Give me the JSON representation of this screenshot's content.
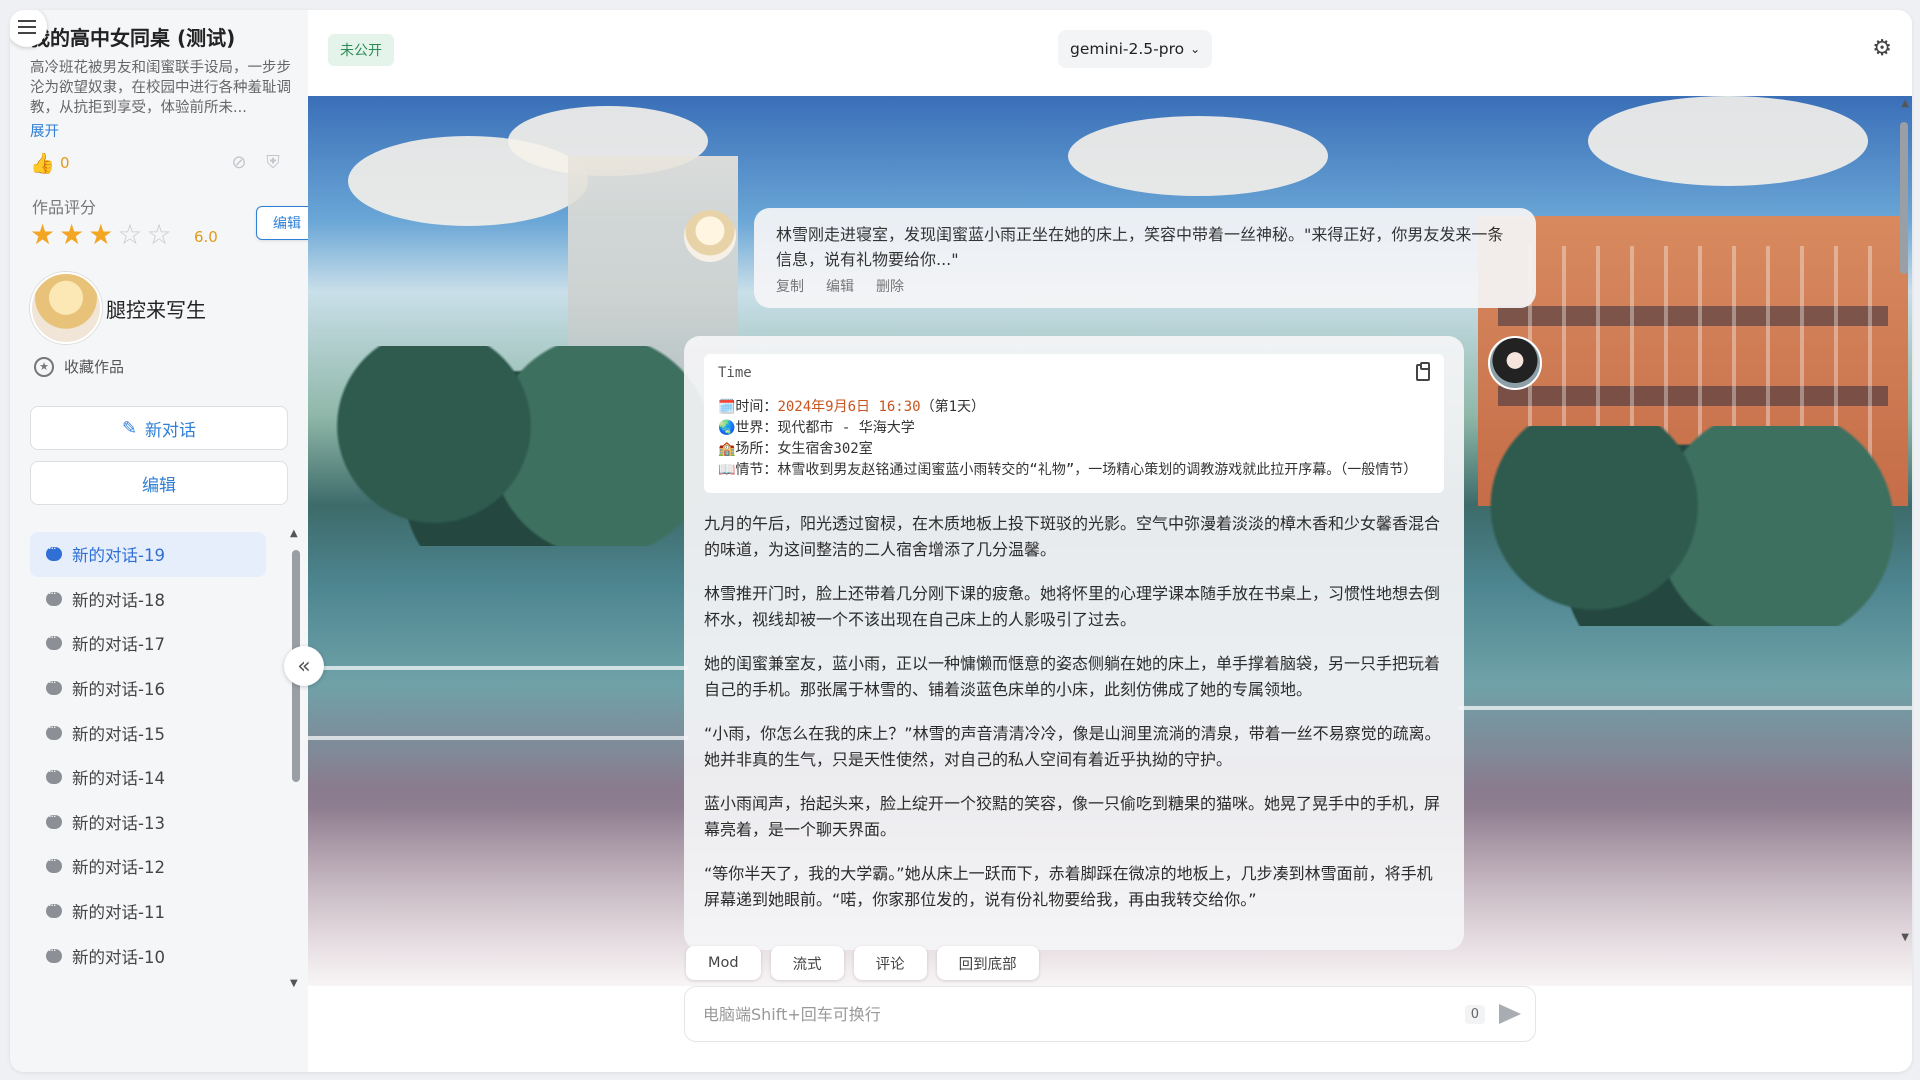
{
  "sidebar": {
    "work_title": "我的高中女同桌 (测试)",
    "work_desc": "高冷班花被男友和闺蜜联手设局，一步步沦为欲望奴隶，在校园中进行各种羞耻调教，从抗拒到享受，体验前所未...",
    "expand_label": "展开",
    "like_count": "0",
    "rating_label": "作品评分",
    "rating_score": "6.0",
    "rating_stars": 3,
    "rating_max": 5,
    "edit_rating_label": "编辑",
    "author_name": "腿控来写生",
    "favorite_label": "收藏作品",
    "new_chat_label": "新对话",
    "edit_label": "编辑",
    "chat_items": [
      {
        "label": "新的对话-19",
        "active": true
      },
      {
        "label": "新的对话-18",
        "active": false
      },
      {
        "label": "新的对话-17",
        "active": false
      },
      {
        "label": "新的对话-16",
        "active": false
      },
      {
        "label": "新的对话-15",
        "active": false
      },
      {
        "label": "新的对话-14",
        "active": false
      },
      {
        "label": "新的对话-13",
        "active": false
      },
      {
        "label": "新的对话-12",
        "active": false
      },
      {
        "label": "新的对话-11",
        "active": false
      },
      {
        "label": "新的对话-10",
        "active": false
      }
    ]
  },
  "header": {
    "private_badge": "未公开",
    "model_name": "gemini-2.5-pro"
  },
  "chat": {
    "first_message": "林雪刚走进寝室，发现闺蜜蓝小雨正坐在她的床上，笑容中带着一丝神秘。\"来得正好，你男友发来一条信息，说有礼物要给你...\"",
    "message_actions": [
      "复制",
      "编辑",
      "删除"
    ],
    "time_card": {
      "title": "Time",
      "time_prefix": "🗓️时间：",
      "time_date": "2024年9月6日 16:30",
      "time_suffix": "（第1天）",
      "world": "🌏世界：现代都市 - 华海大学",
      "place": "🏫场所：女生宿舍302室",
      "plot": "📖情节：林雪收到男友赵铭通过闺蜜蓝小雨转交的“礼物”，一场精心策划的调教游戏就此拉开序幕。（一般情节）"
    },
    "paragraphs": [
      "九月的午后，阳光透过窗棂，在木质地板上投下斑驳的光影。空气中弥漫着淡淡的樟木香和少女馨香混合的味道，为这间整洁的二人宿舍增添了几分温馨。",
      "林雪推开门时，脸上还带着几分刚下课的疲惫。她将怀里的心理学课本随手放在书桌上，习惯性地想去倒杯水，视线却被一个不该出现在自己床上的人影吸引了过去。",
      "她的闺蜜兼室友，蓝小雨，正以一种慵懒而惬意的姿态侧躺在她的床上，单手撑着脑袋，另一只手把玩着自己的手机。那张属于林雪的、铺着淡蓝色床单的小床，此刻仿佛成了她的专属领地。",
      "“小雨，你怎么在我的床上？”林雪的声音清清冷冷，像是山涧里流淌的清泉，带着一丝不易察觉的疏离。她并非真的生气，只是天性使然，对自己的私人空间有着近乎执拗的守护。",
      "蓝小雨闻声，抬起头来，脸上绽开一个狡黠的笑容，像一只偷吃到糖果的猫咪。她晃了晃手中的手机，屏幕亮着，是一个聊天界面。",
      "“等你半天了，我的大学霸。”她从床上一跃而下，赤着脚踩在微凉的地板上，几步凑到林雪面前，将手机屏幕递到她眼前。“喏，你家那位发的，说有份礼物要给我，再由我转交给你。”"
    ]
  },
  "action_bar": [
    "Mod",
    "流式",
    "评论",
    "回到底部"
  ],
  "input": {
    "placeholder": "电脑端Shift+回车可换行",
    "char_count": "0"
  },
  "colors": {
    "accent": "#2f7fd6",
    "private_badge_bg": "#e4f4ea",
    "private_badge_text": "#2e8b57",
    "star": "#f2a623",
    "time_highlight": "#c9541f"
  }
}
